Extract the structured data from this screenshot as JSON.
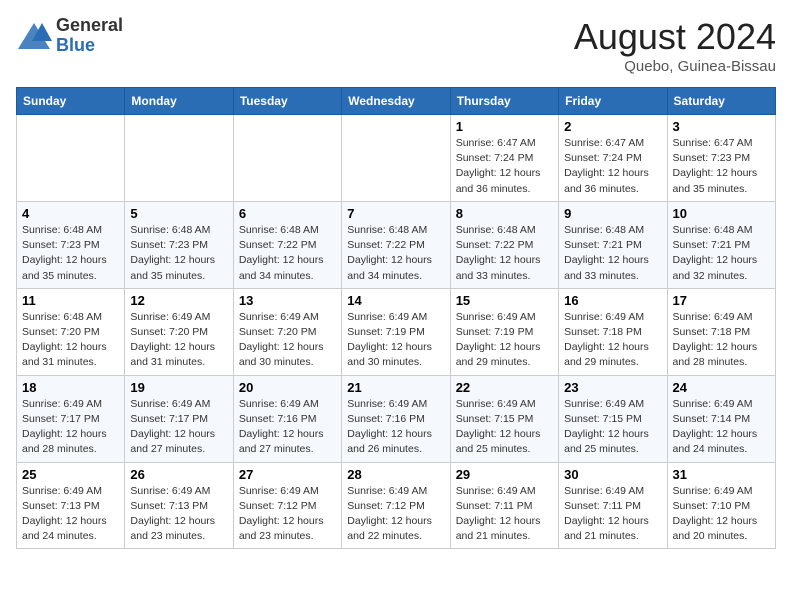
{
  "header": {
    "logo_general": "General",
    "logo_blue": "Blue",
    "month_title": "August 2024",
    "location": "Quebo, Guinea-Bissau"
  },
  "days_of_week": [
    "Sunday",
    "Monday",
    "Tuesday",
    "Wednesday",
    "Thursday",
    "Friday",
    "Saturday"
  ],
  "weeks": [
    [
      {
        "day": "",
        "info": ""
      },
      {
        "day": "",
        "info": ""
      },
      {
        "day": "",
        "info": ""
      },
      {
        "day": "",
        "info": ""
      },
      {
        "day": "1",
        "info": "Sunrise: 6:47 AM\nSunset: 7:24 PM\nDaylight: 12 hours\nand 36 minutes."
      },
      {
        "day": "2",
        "info": "Sunrise: 6:47 AM\nSunset: 7:24 PM\nDaylight: 12 hours\nand 36 minutes."
      },
      {
        "day": "3",
        "info": "Sunrise: 6:47 AM\nSunset: 7:23 PM\nDaylight: 12 hours\nand 35 minutes."
      }
    ],
    [
      {
        "day": "4",
        "info": "Sunrise: 6:48 AM\nSunset: 7:23 PM\nDaylight: 12 hours\nand 35 minutes."
      },
      {
        "day": "5",
        "info": "Sunrise: 6:48 AM\nSunset: 7:23 PM\nDaylight: 12 hours\nand 35 minutes."
      },
      {
        "day": "6",
        "info": "Sunrise: 6:48 AM\nSunset: 7:22 PM\nDaylight: 12 hours\nand 34 minutes."
      },
      {
        "day": "7",
        "info": "Sunrise: 6:48 AM\nSunset: 7:22 PM\nDaylight: 12 hours\nand 34 minutes."
      },
      {
        "day": "8",
        "info": "Sunrise: 6:48 AM\nSunset: 7:22 PM\nDaylight: 12 hours\nand 33 minutes."
      },
      {
        "day": "9",
        "info": "Sunrise: 6:48 AM\nSunset: 7:21 PM\nDaylight: 12 hours\nand 33 minutes."
      },
      {
        "day": "10",
        "info": "Sunrise: 6:48 AM\nSunset: 7:21 PM\nDaylight: 12 hours\nand 32 minutes."
      }
    ],
    [
      {
        "day": "11",
        "info": "Sunrise: 6:48 AM\nSunset: 7:20 PM\nDaylight: 12 hours\nand 31 minutes."
      },
      {
        "day": "12",
        "info": "Sunrise: 6:49 AM\nSunset: 7:20 PM\nDaylight: 12 hours\nand 31 minutes."
      },
      {
        "day": "13",
        "info": "Sunrise: 6:49 AM\nSunset: 7:20 PM\nDaylight: 12 hours\nand 30 minutes."
      },
      {
        "day": "14",
        "info": "Sunrise: 6:49 AM\nSunset: 7:19 PM\nDaylight: 12 hours\nand 30 minutes."
      },
      {
        "day": "15",
        "info": "Sunrise: 6:49 AM\nSunset: 7:19 PM\nDaylight: 12 hours\nand 29 minutes."
      },
      {
        "day": "16",
        "info": "Sunrise: 6:49 AM\nSunset: 7:18 PM\nDaylight: 12 hours\nand 29 minutes."
      },
      {
        "day": "17",
        "info": "Sunrise: 6:49 AM\nSunset: 7:18 PM\nDaylight: 12 hours\nand 28 minutes."
      }
    ],
    [
      {
        "day": "18",
        "info": "Sunrise: 6:49 AM\nSunset: 7:17 PM\nDaylight: 12 hours\nand 28 minutes."
      },
      {
        "day": "19",
        "info": "Sunrise: 6:49 AM\nSunset: 7:17 PM\nDaylight: 12 hours\nand 27 minutes."
      },
      {
        "day": "20",
        "info": "Sunrise: 6:49 AM\nSunset: 7:16 PM\nDaylight: 12 hours\nand 27 minutes."
      },
      {
        "day": "21",
        "info": "Sunrise: 6:49 AM\nSunset: 7:16 PM\nDaylight: 12 hours\nand 26 minutes."
      },
      {
        "day": "22",
        "info": "Sunrise: 6:49 AM\nSunset: 7:15 PM\nDaylight: 12 hours\nand 25 minutes."
      },
      {
        "day": "23",
        "info": "Sunrise: 6:49 AM\nSunset: 7:15 PM\nDaylight: 12 hours\nand 25 minutes."
      },
      {
        "day": "24",
        "info": "Sunrise: 6:49 AM\nSunset: 7:14 PM\nDaylight: 12 hours\nand 24 minutes."
      }
    ],
    [
      {
        "day": "25",
        "info": "Sunrise: 6:49 AM\nSunset: 7:13 PM\nDaylight: 12 hours\nand 24 minutes."
      },
      {
        "day": "26",
        "info": "Sunrise: 6:49 AM\nSunset: 7:13 PM\nDaylight: 12 hours\nand 23 minutes."
      },
      {
        "day": "27",
        "info": "Sunrise: 6:49 AM\nSunset: 7:12 PM\nDaylight: 12 hours\nand 23 minutes."
      },
      {
        "day": "28",
        "info": "Sunrise: 6:49 AM\nSunset: 7:12 PM\nDaylight: 12 hours\nand 22 minutes."
      },
      {
        "day": "29",
        "info": "Sunrise: 6:49 AM\nSunset: 7:11 PM\nDaylight: 12 hours\nand 21 minutes."
      },
      {
        "day": "30",
        "info": "Sunrise: 6:49 AM\nSunset: 7:11 PM\nDaylight: 12 hours\nand 21 minutes."
      },
      {
        "day": "31",
        "info": "Sunrise: 6:49 AM\nSunset: 7:10 PM\nDaylight: 12 hours\nand 20 minutes."
      }
    ]
  ]
}
